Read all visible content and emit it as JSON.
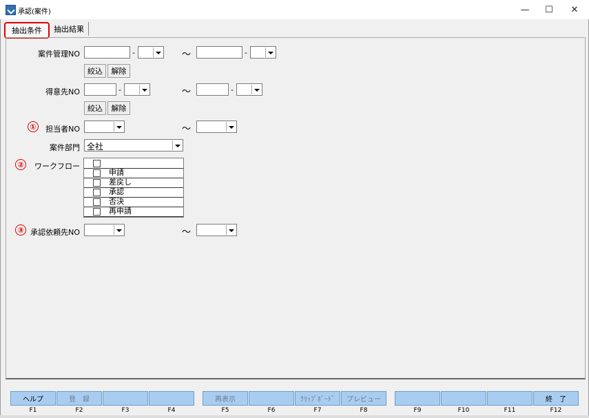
{
  "window": {
    "title": "承認(案件)",
    "minimize": "—",
    "maximize": "☐",
    "close": "✕"
  },
  "tabs": [
    {
      "label": "抽出条件",
      "active": true
    },
    {
      "label": "抽出結果",
      "active": false
    }
  ],
  "form": {
    "case_no": {
      "label": "案件管理NO",
      "buttons": [
        "絞込",
        "解除"
      ]
    },
    "client_no": {
      "label": "得意先NO",
      "buttons": [
        "絞込",
        "解除"
      ]
    },
    "staff_no": {
      "label": "担当者NO",
      "marker": "①"
    },
    "dept": {
      "label": "案件部門",
      "value": "全社"
    },
    "workflow": {
      "label": "ワークフロー",
      "marker": "②",
      "items": [
        "",
        "申請",
        "差戻し",
        "承認",
        "否決",
        "再申請"
      ]
    },
    "approver_no": {
      "label": "承認依頼先NO",
      "marker": "③"
    },
    "dash": "-",
    "tilde": "～"
  },
  "function_keys": [
    {
      "label": "ヘルプ",
      "key": "F1",
      "enabled": true
    },
    {
      "label": "登　録",
      "key": "F2",
      "enabled": false
    },
    {
      "label": "",
      "key": "F3",
      "enabled": true
    },
    {
      "label": "",
      "key": "F4",
      "enabled": true
    },
    {
      "label": "再表示",
      "key": "F5",
      "enabled": false
    },
    {
      "label": "",
      "key": "F6",
      "enabled": true
    },
    {
      "label": "ｸﾘｯﾌﾟﾎﾞｰﾄﾞ",
      "key": "F7",
      "enabled": false
    },
    {
      "label": "プレビュー",
      "key": "F8",
      "enabled": false
    },
    {
      "label": "",
      "key": "F9",
      "enabled": true
    },
    {
      "label": "",
      "key": "F10",
      "enabled": true
    },
    {
      "label": "",
      "key": "F11",
      "enabled": true
    },
    {
      "label": "終　了",
      "key": "F12",
      "enabled": true
    }
  ],
  "colors": {
    "fbar": "#a9cdf0",
    "highlight": "#e00000"
  }
}
